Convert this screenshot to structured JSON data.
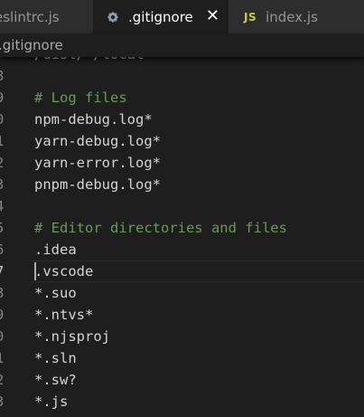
{
  "tabs": [
    {
      "label": "eslintrc.js",
      "active": false
    },
    {
      "label": ".gitignore",
      "active": true,
      "icon": "gear-icon",
      "close": "✕"
    },
    {
      "label": "index.js",
      "active": false,
      "icon": "JS"
    }
  ],
  "breadcrumb": ".gitignore",
  "editor": {
    "lines": [
      {
        "number": "",
        "text": "/dist/ /local",
        "kind": "text"
      },
      {
        "number": "8",
        "text": "",
        "kind": "text"
      },
      {
        "number": "9",
        "text": "# Log files",
        "kind": "comment"
      },
      {
        "number": "0",
        "text": "npm-debug.log*",
        "kind": "text"
      },
      {
        "number": "1",
        "text": "yarn-debug.log*",
        "kind": "text"
      },
      {
        "number": "2",
        "text": "yarn-error.log*",
        "kind": "text"
      },
      {
        "number": "3",
        "text": "pnpm-debug.log*",
        "kind": "text"
      },
      {
        "number": "4",
        "text": "",
        "kind": "text"
      },
      {
        "number": "5",
        "text": "# Editor directories and files",
        "kind": "comment"
      },
      {
        "number": "6",
        "text": ".idea",
        "kind": "text"
      },
      {
        "number": "7",
        "text": ".vscode",
        "kind": "text",
        "current": true
      },
      {
        "number": "8",
        "text": "*.suo",
        "kind": "text"
      },
      {
        "number": "9",
        "text": "*.ntvs*",
        "kind": "text"
      },
      {
        "number": "0",
        "text": "*.njsproj",
        "kind": "text"
      },
      {
        "number": "1",
        "text": "*.sln",
        "kind": "text"
      },
      {
        "number": "2",
        "text": "*.sw?",
        "kind": "text"
      },
      {
        "number": "3",
        "text": "*.js",
        "kind": "text"
      }
    ]
  },
  "colors": {
    "editor_background": "#1e1e1e",
    "tabbar_background": "#252526",
    "comment": "#6a9955",
    "text": "#d4d4d4",
    "line_number": "#858585",
    "js_icon": "#cbcb41"
  }
}
